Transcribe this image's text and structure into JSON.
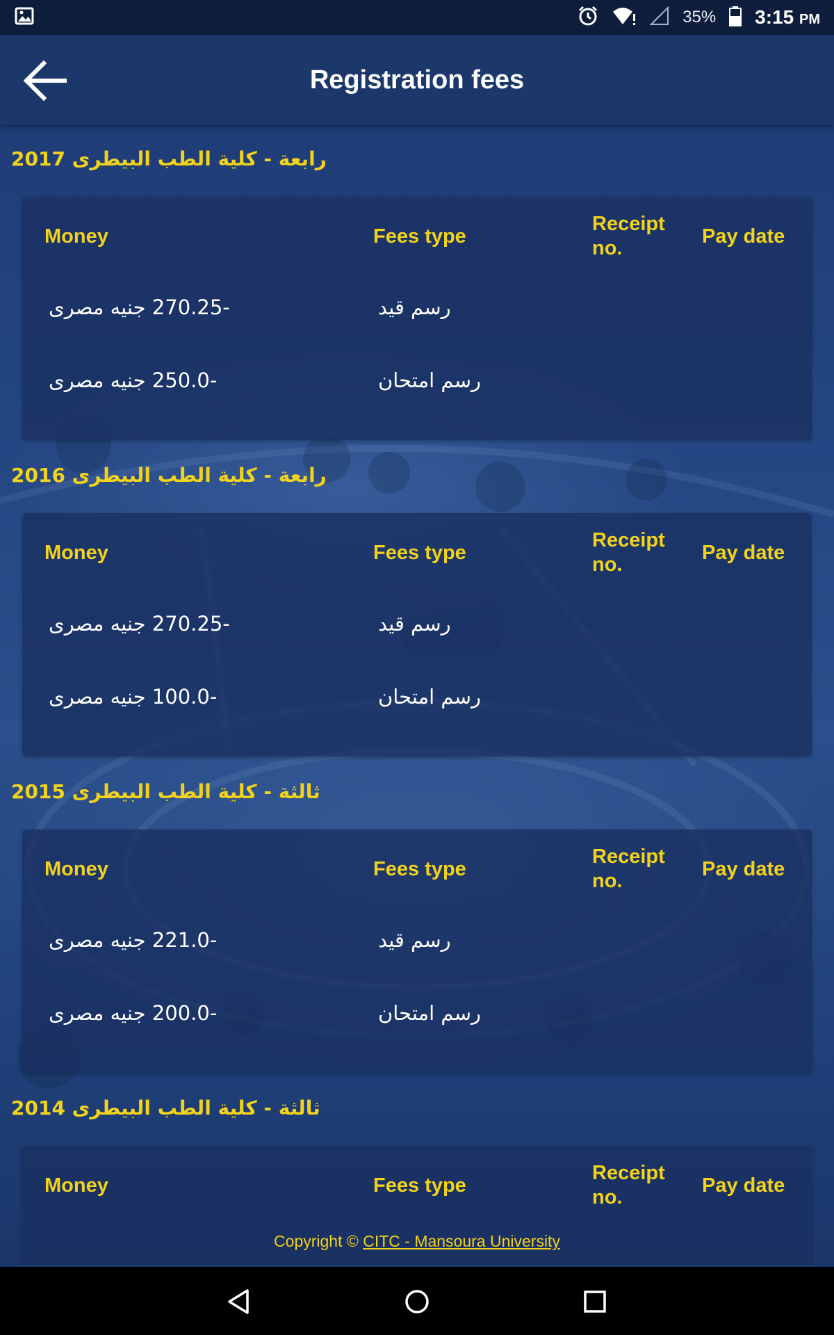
{
  "status_bar": {
    "battery_percent": "35%",
    "time": "3:15",
    "time_suffix": "PM",
    "icons": [
      "image-icon",
      "alarm-icon",
      "wifi-alert-icon",
      "signal-icon",
      "battery-icon"
    ]
  },
  "app_bar": {
    "title": "Registration fees",
    "back_icon": "arrow-left-icon"
  },
  "table_headers": {
    "money": "Money",
    "fees_type": "Fees type",
    "receipt_no_1": "Receipt",
    "receipt_no_2": "no.",
    "pay_date": "Pay date"
  },
  "sections": [
    {
      "title": "رابعة - كلية الطب البيطرى 2017",
      "rows": [
        {
          "money": "-270.25 جنيه مصرى",
          "fees_type": "رسم قيد",
          "receipt_no": "",
          "pay_date": ""
        },
        {
          "money": "-250.0 جنيه مصرى",
          "fees_type": "رسم امتحان",
          "receipt_no": "",
          "pay_date": ""
        }
      ]
    },
    {
      "title": "رابعة - كلية الطب البيطرى 2016",
      "rows": [
        {
          "money": "-270.25 جنيه مصرى",
          "fees_type": "رسم قيد",
          "receipt_no": "",
          "pay_date": ""
        },
        {
          "money": "-100.0 جنيه مصرى",
          "fees_type": "رسم امتحان",
          "receipt_no": "",
          "pay_date": ""
        }
      ]
    },
    {
      "title": "ثالثة - كلية الطب البيطرى 2015",
      "rows": [
        {
          "money": "-221.0 جنيه مصرى",
          "fees_type": "رسم قيد",
          "receipt_no": "",
          "pay_date": ""
        },
        {
          "money": "-200.0 جنيه مصرى",
          "fees_type": "رسم امتحان",
          "receipt_no": "",
          "pay_date": ""
        }
      ]
    },
    {
      "title": "ثالثة - كلية الطب البيطرى 2014",
      "rows": []
    }
  ],
  "footer": {
    "prefix": "Copyright © ",
    "link_text": "CITC - Mansoura University"
  },
  "nav_bar": {
    "icons": [
      "back-triangle-icon",
      "home-circle-icon",
      "recents-square-icon"
    ]
  },
  "colors": {
    "accent_yellow": "#f2d21a",
    "status_bar": "#0f1d3d",
    "app_bar": "#1c3769",
    "card": "#1a3060"
  }
}
